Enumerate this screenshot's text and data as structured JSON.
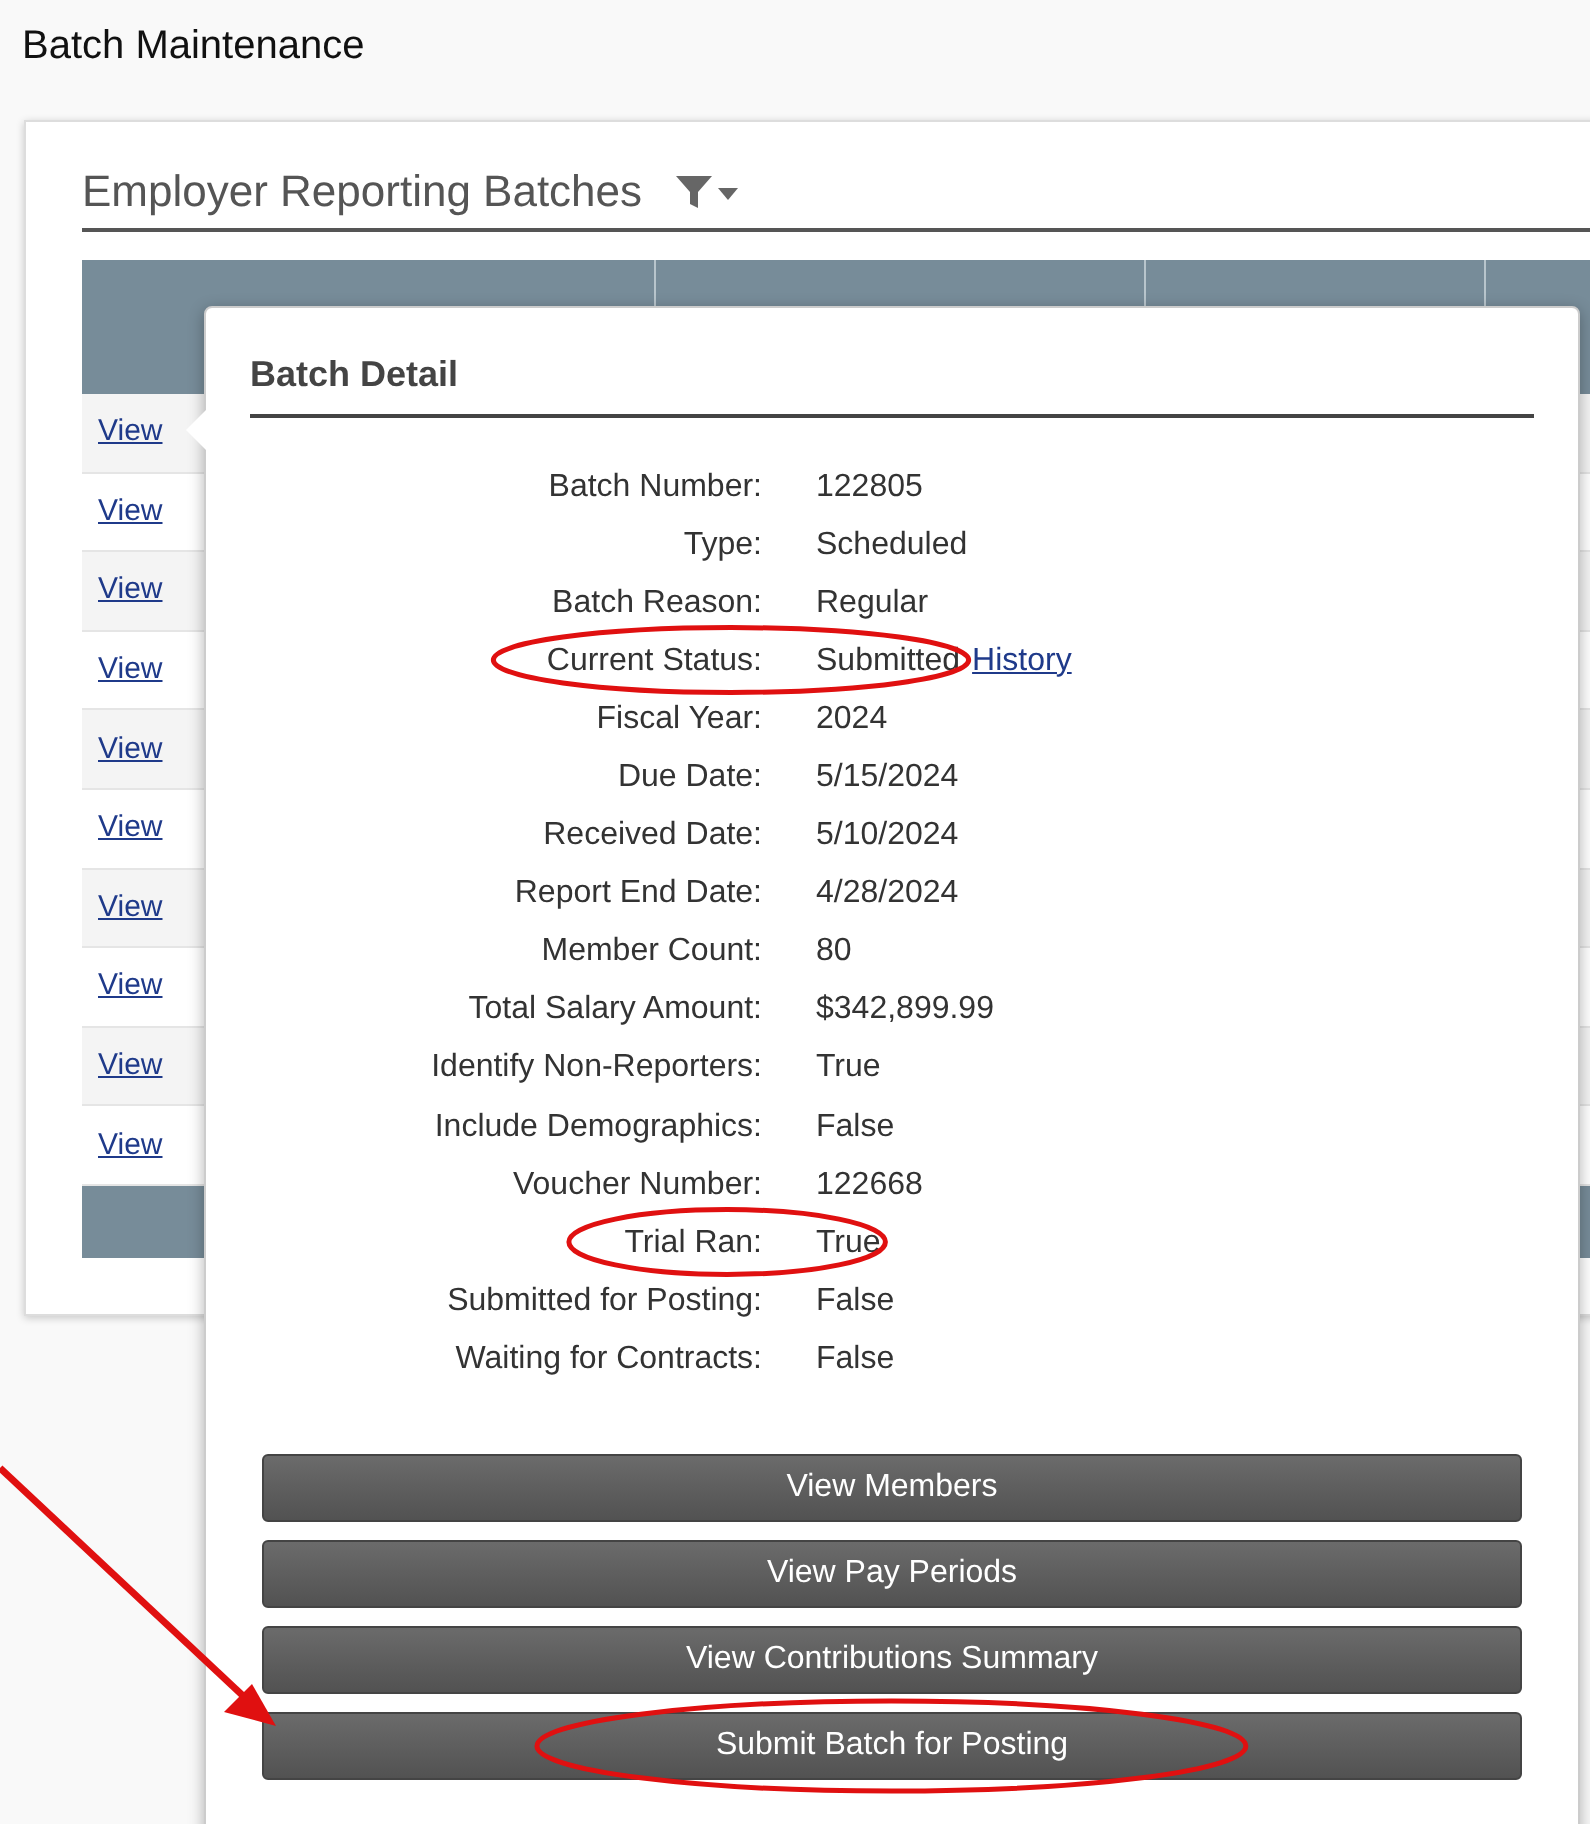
{
  "page_title": "Batch Maintenance",
  "grid": {
    "title": "Employer Reporting Batches",
    "rows": [
      {
        "link": "View"
      },
      {
        "link": "View"
      },
      {
        "link": "View"
      },
      {
        "link": "View"
      },
      {
        "link": "View"
      },
      {
        "link": "View"
      },
      {
        "link": "View"
      },
      {
        "link": "View"
      },
      {
        "link": "View"
      },
      {
        "link": "View"
      }
    ]
  },
  "batch_detail": {
    "title": "Batch Detail",
    "fields": [
      {
        "label": "Batch Number:",
        "value": "122805",
        "circled": false
      },
      {
        "label": "Type:",
        "value": "Scheduled",
        "circled": false
      },
      {
        "label": "Batch Reason:",
        "value": "Regular",
        "circled": false
      },
      {
        "label": "Current Status:",
        "value": "Submitted",
        "link": "History",
        "circled": true
      },
      {
        "label": "Fiscal Year:",
        "value": "2024",
        "circled": false
      },
      {
        "label": "Due Date:",
        "value": "5/15/2024",
        "circled": false
      },
      {
        "label": "Received Date:",
        "value": "5/10/2024",
        "circled": false
      },
      {
        "label": "Report End Date:",
        "value": "4/28/2024",
        "circled": false
      },
      {
        "label": "Member Count:",
        "value": "80",
        "circled": false
      },
      {
        "label": "Total Salary Amount:",
        "value": "$342,899.99",
        "circled": false
      },
      {
        "label": "Identify Non-Reporters:",
        "value": "True",
        "circled": false
      },
      {
        "label": "Include Demographics:",
        "value": "False",
        "circled": false
      },
      {
        "label": "Voucher Number:",
        "value": "122668",
        "circled": false
      },
      {
        "label": "Trial Ran:",
        "value": "True",
        "circled": true
      },
      {
        "label": "Submitted for Posting:",
        "value": "False",
        "circled": false
      },
      {
        "label": "Waiting for Contracts:",
        "value": "False",
        "circled": false
      }
    ],
    "buttons": [
      {
        "label": "View Members",
        "circled": false,
        "arrow": false
      },
      {
        "label": "View Pay Periods",
        "circled": false,
        "arrow": false
      },
      {
        "label": "View Contributions Summary",
        "circled": false,
        "arrow": false
      },
      {
        "label": "Submit Batch for Posting",
        "circled": true,
        "arrow": true
      }
    ]
  }
}
